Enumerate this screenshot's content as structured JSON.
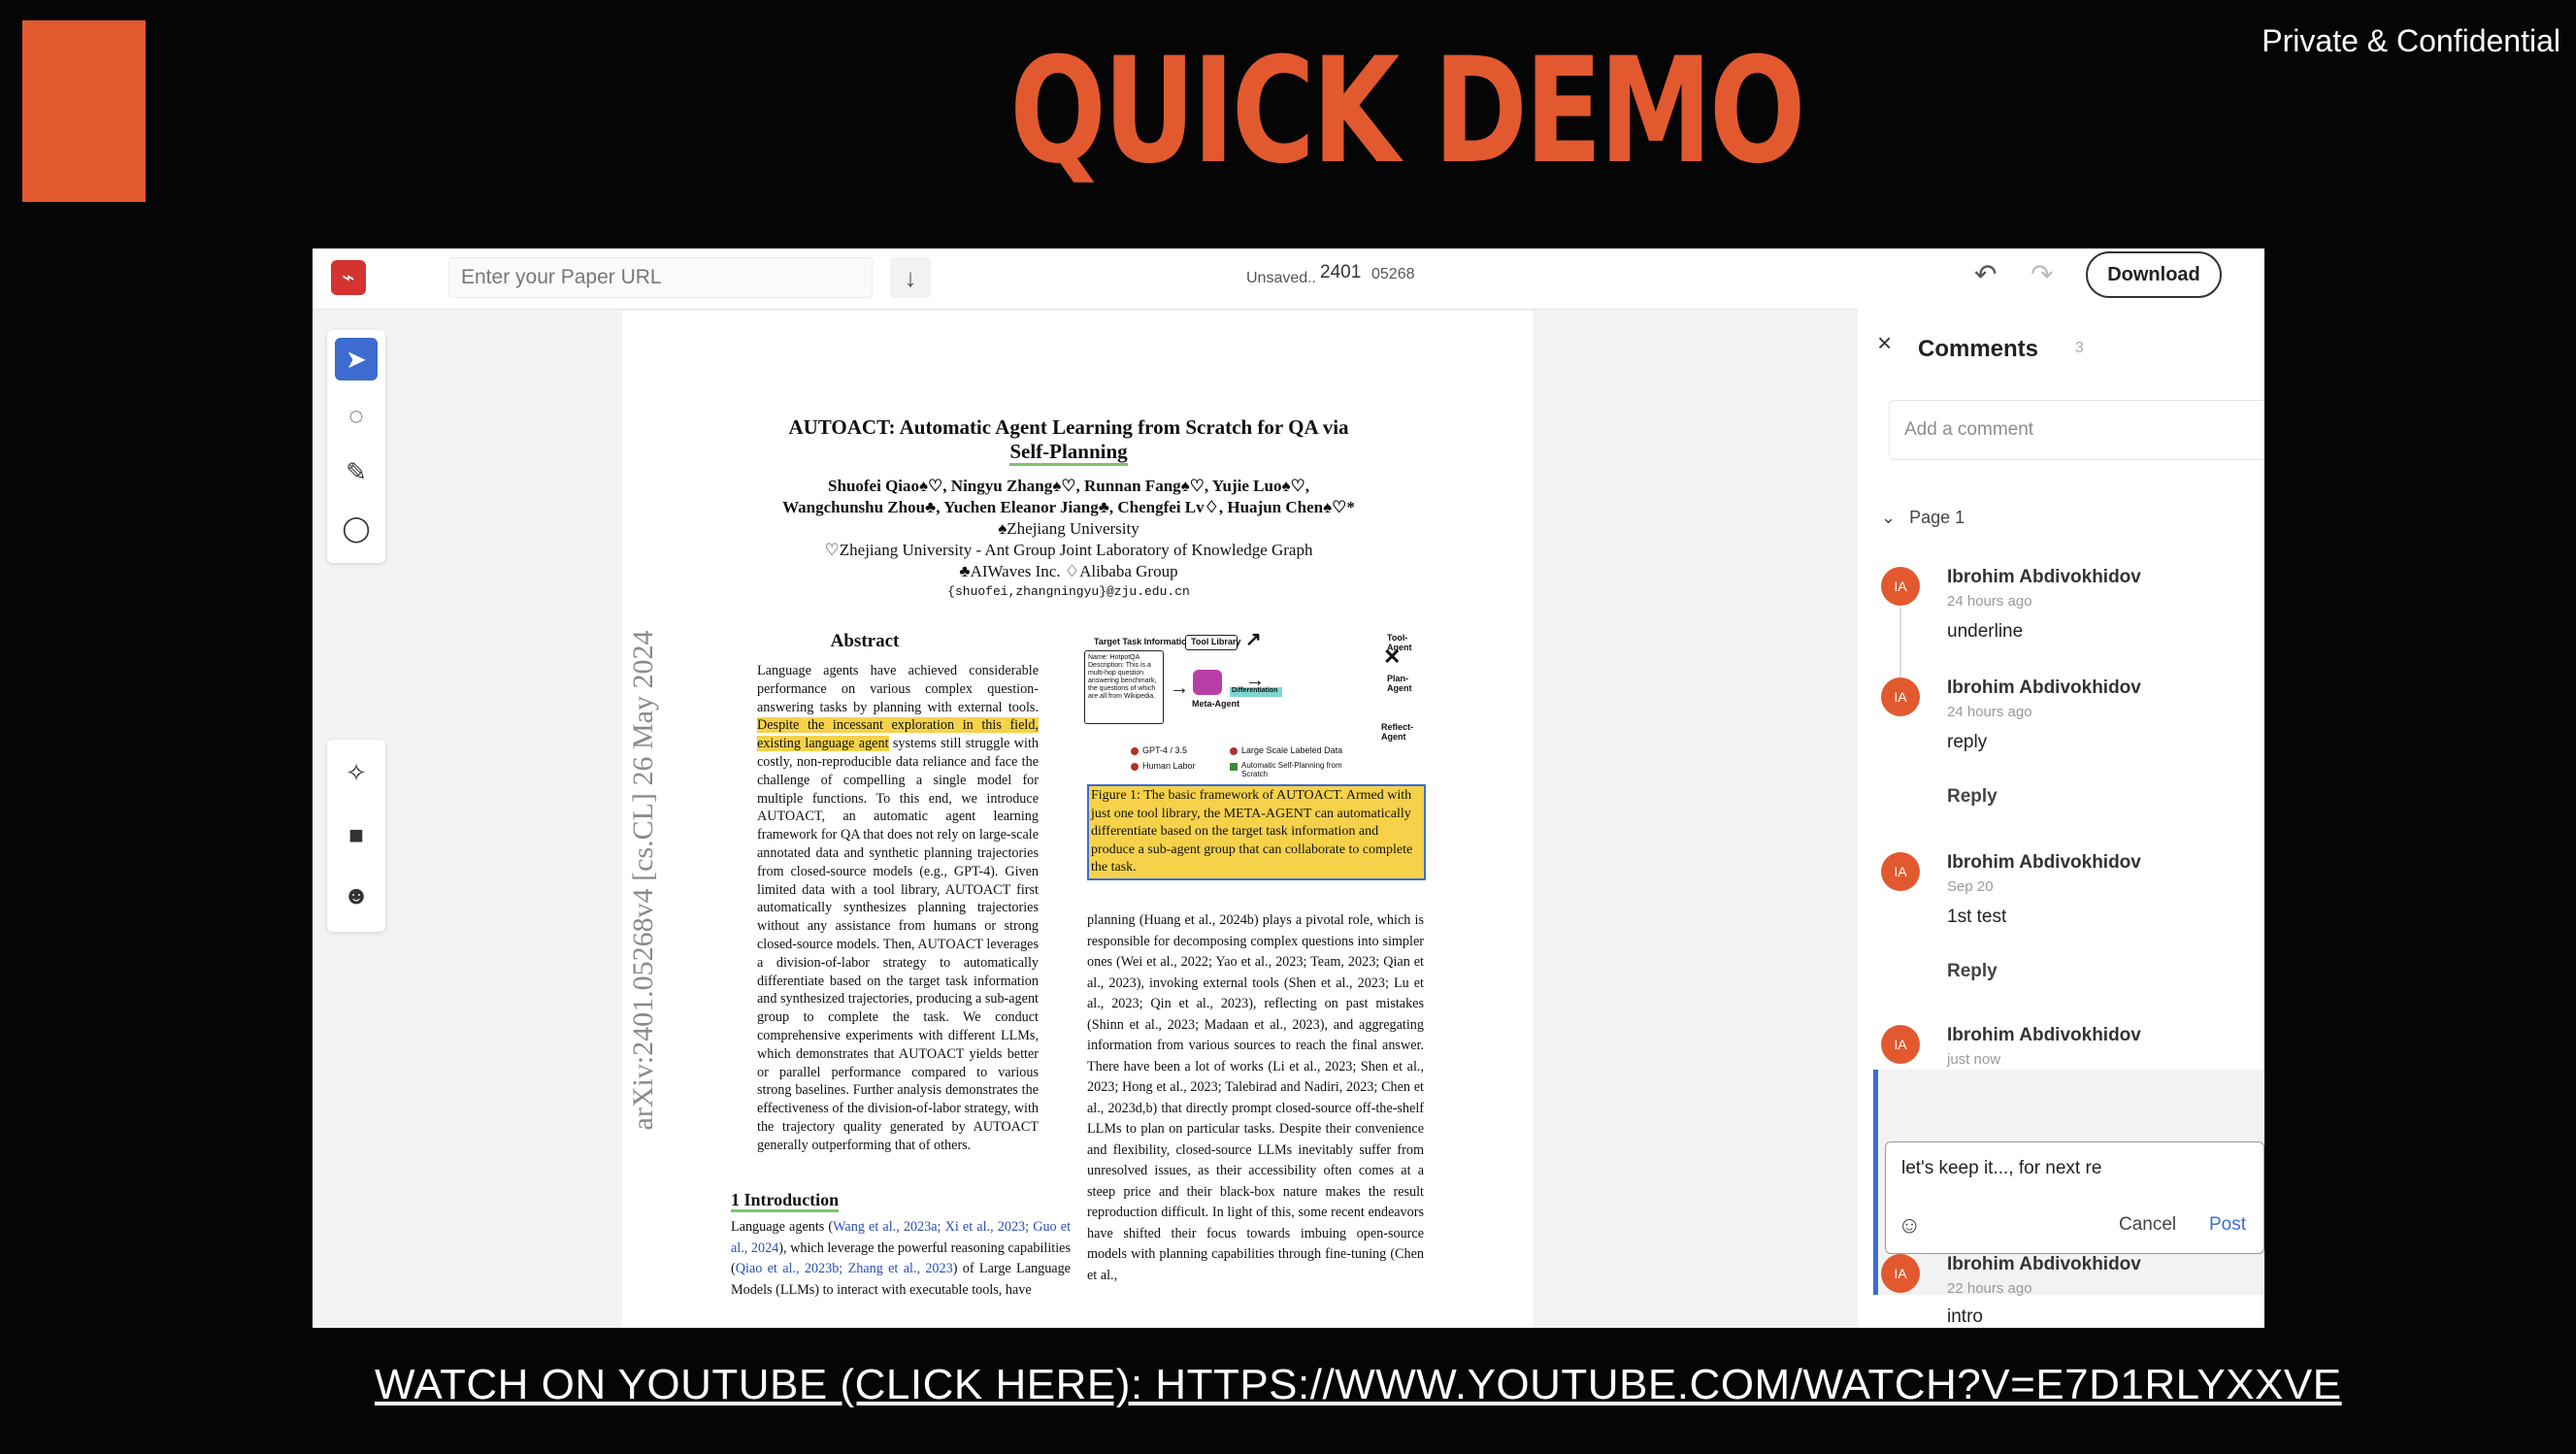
{
  "slide": {
    "title": "QUICK DEMO",
    "confidential": "Private & Confidential",
    "youtube_link": "WATCH ON YOUTUBE (CLICK HERE): HTTPS://WWW.YOUTUBE.COM/WATCH?V=E7D1RLYXXVE",
    "accent_color": "#E2592F",
    "background_color": "#050505"
  },
  "app": {
    "topbar": {
      "logo_icon": "pdf-icon",
      "url_placeholder": "Enter your Paper URL",
      "fetch_icon": "arrow-down-icon",
      "unsaved": "Unsaved..",
      "doc_id_1": "2401",
      "doc_id_2": "05268",
      "undo_icon": "undo-icon",
      "redo_icon": "redo-icon",
      "download_label": "Download"
    },
    "tools": [
      "cursor-icon",
      "comment-icon",
      "highlighter-icon",
      "lasso-icon",
      "magic-wand-icon",
      "lock-icon",
      "users-icon"
    ]
  },
  "paper": {
    "side_label": "arXiv:2401.05268v4  [cs.CL]  26 May 2024",
    "title_line1": "AUTOACT: Automatic Agent Learning from Scratch for QA via",
    "title_line2": "Self-Planning",
    "authors_line1": "Shuofei Qiao♠♡, Ningyu Zhang♠♡, Runnan Fang♠♡, Yujie Luo♠♡,",
    "authors_line2": "Wangchunshu Zhou♣, Yuchen Eleanor Jiang♣, Chengfei Lv♢, Huajun Chen♠♡*",
    "affil_1": "♠Zhejiang University",
    "affil_2": "♡Zhejiang University - Ant Group Joint Laboratory of Knowledge Graph",
    "affil_3": "♣AIWaves Inc.   ♢Alibaba Group",
    "email": "{shuofei,zhangningyu}@zju.edu.cn",
    "abstract_heading": "Abstract",
    "abstract_pre": "Language agents have achieved considerable performance on various complex question-answering tasks by planning with external tools. ",
    "abstract_highlight": "Despite the incessant exploration in this field, existing language agent",
    "abstract_post": " systems still struggle with costly, non-reproducible data reliance and face the challenge of compelling a single model for multiple functions. To this end, we introduce AUTOACT, an automatic agent learning framework for QA that does not rely on large-scale annotated data and synthetic planning trajectories from closed-source models (e.g., GPT-4). Given limited data with a tool library, AUTOACT first automatically synthesizes planning trajectories without any assistance from humans or strong closed-source models. Then, AUTOACT leverages a division-of-labor strategy to automatically differentiate based on the target task information and synthesized trajectories, producing a sub-agent group to complete the task. We conduct comprehensive experiments with different LLMs, which demonstrates that AUTOACT yields better or parallel performance compared to various strong baselines. Further analysis demonstrates the effectiveness of the division-of-labor strategy, with the trajectory quality generated by AUTOACT generally outperforming that of others.",
    "figure_labels": {
      "task_info": "Target Task Information",
      "task_desc": "Name: HotpotQA Description: This is a multi-hop question answering benchmark, the questions of which are all from Wikipedia.",
      "tool_library": "Tool Library",
      "tool_agent": "Tool-Agent",
      "plan_agent": "Plan-Agent",
      "reflect_agent": "Reflect-Agent",
      "meta_agent": "Meta-Agent",
      "differentiation": "Differentiation",
      "legend_1": "GPT-4 / 3.5",
      "legend_2": "Human Labor",
      "legend_3": "Large Scale Labeled Data",
      "legend_4": "Automatic Self-Planning from Scratch"
    },
    "caption": "Figure 1: The basic framework of AUTOACT. Armed with just one tool library, the META-AGENT can automatically differentiate based on the target task information and produce a sub-agent group that can collaborate to complete the task.",
    "intro_heading": "1   Introduction",
    "intro_pre": "Language agents (",
    "intro_cite1": "Wang et al., 2023a; Xi et al., 2023; Guo et al., 2024",
    "intro_mid": "), which leverage the powerful reasoning capabilities (",
    "intro_cite2": "Qiao et al., 2023b; Zhang et al., 2023",
    "intro_post": ") of Large Language Models (LLMs) to interact with executable tools, have",
    "right_col": "planning (Huang et al., 2024b) plays a pivotal role, which is responsible for decomposing complex questions into simpler ones (Wei et al., 2022; Yao et al., 2023; Team, 2023; Qian et al., 2023), invoking external tools (Shen et al., 2023; Lu et al., 2023; Qin et al., 2023), reflecting on past mistakes (Shinn et al., 2023; Madaan et al., 2023), and aggregating information from various sources to reach the final answer. There have been a lot of works (Li et al., 2023; Shen et al., 2023; Hong et al., 2023; Talebirad and Nadiri, 2023; Chen et al., 2023d,b) that directly prompt closed-source off-the-shelf LLMs to plan on particular tasks. Despite their convenience and flexibility, closed-source LLMs inevitably suffer from unresolved issues, as their accessibility often comes at a steep price and their black-box nature makes the result reproduction difficult. In light of this, some recent endeavors have shifted their focus towards imbuing open-source models with planning capabilities through fine-tuning (Chen et al.,"
  },
  "comments": {
    "title": "Comments",
    "count": "3",
    "add_placeholder": "Add a comment",
    "page_label": "Page 1",
    "page_count": "3",
    "items": [
      {
        "initials": "IA",
        "name": "Ibrohim Abdivokhidov",
        "time": "24 hours ago",
        "body": "underline"
      },
      {
        "initials": "IA",
        "name": "Ibrohim Abdivokhidov",
        "time": "24 hours ago",
        "body": "reply",
        "reply": "Reply"
      },
      {
        "initials": "IA",
        "name": "Ibrohim Abdivokhidov",
        "time": "Sep 20",
        "body": "1st test",
        "reply": "Reply"
      },
      {
        "initials": "IA",
        "name": "Ibrohim Abdivokhidov",
        "time": "just now"
      },
      {
        "initials": "IA",
        "name": "Ibrohim Abdivokhidov",
        "time": "22 hours ago",
        "body": "intro"
      }
    ],
    "draft": "let's keep it..., for next re",
    "cancel_label": "Cancel",
    "post_label": "Post"
  }
}
